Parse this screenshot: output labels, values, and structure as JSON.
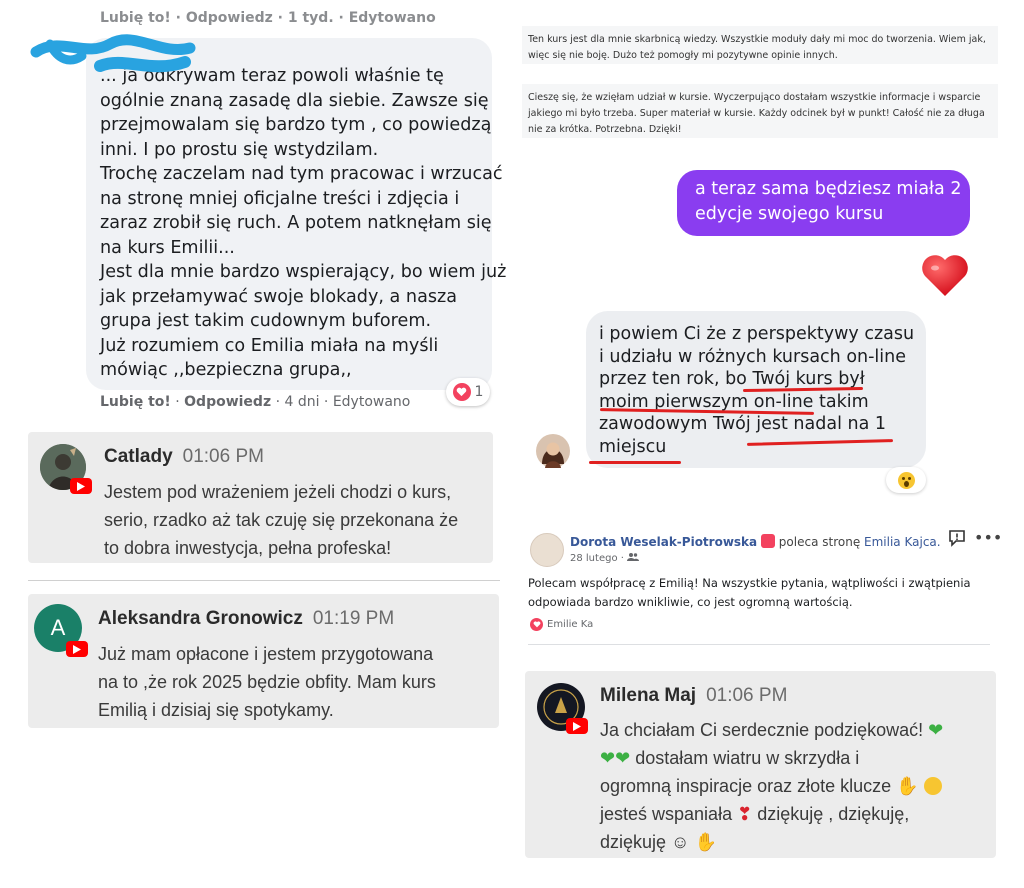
{
  "left": {
    "fb_comment": {
      "top_cut_text": "Lubię to! · Odpowiedz · 1 tyd. · Edytowano",
      "lines": [
        "... ja odkrywam teraz powoli właśnie tę",
        "ogólnie znaną zasadę dla siebie. Zawsze się",
        "przejmowalam się bardzo tym , co powiedzą",
        "inni. I po prostu się wstydzilam.",
        "Trochę zaczelam nad tym pracowac i wrzucać",
        "na stronę mniej oficjalne treści i zdjęcia i",
        "zaraz zrobił się ruch. A potem natknęłam się",
        "na kurs Emilii...",
        "Jest dla mnie bardzo wspierający, bo wiem już",
        "jak przełamywać swoje blokady, a nasza",
        "grupa jest takim cudownym buforem.",
        "Już rozumiem co Emilia miała na myśli",
        "mówiąc ,,bezpieczna grupa,,"
      ],
      "reaction_count": "1",
      "like_label": "Lubię to!",
      "reply_label": "Odpowiedz",
      "meta": "· 4 dni · Edytowano"
    },
    "yt_comments": [
      {
        "name": "Catlady",
        "time": "01:06 PM",
        "lines": [
          "Jestem pod wrażeniem jeżeli chodzi o kurs,",
          "serio, rzadko aż tak czuję się przekonana że",
          "to dobra inwestycja, pełna profeska!"
        ]
      },
      {
        "name": "Aleksandra Gronowicz",
        "time": "01:19 PM",
        "avatar_letter": "A",
        "lines": [
          "Już mam opłacone i jestem przygotowana",
          "na to ,że rok 2025 będzie obfity. Mam kurs",
          "Emilią i dzisiaj się spotykamy."
        ]
      }
    ]
  },
  "right": {
    "reviews": [
      "Ten kurs jest dla mnie skarbnicą wiedzy. Wszystkie moduły dały mi moc do tworzenia. Wiem jak, więc się nie boję. Dużo też pomogły mi pozytywne opinie innych.",
      "Cieszę się, że wzięłam udział w kursie. Wyczerpująco dostałam wszystkie informacje i wsparcie jakiego mi było trzeba. Super materiał w kursie. Każdy odcinek był w punkt! Całość nie za długa nie za krótka. Potrzebna. Dzięki!"
    ],
    "chat": {
      "sent_lines": [
        "a teraz sama będziesz miała 2",
        "edycje swojego kursu"
      ],
      "received_lines": [
        "i powiem Ci że z perspektywy czasu",
        "i udziału w różnych kursach on-line",
        "przez ten rok, bo Twój kurs był",
        "moim pierwszym on-line takim",
        "zawodowym Twój jest nadal na 1",
        "miejscu"
      ]
    },
    "recommendation": {
      "author": "Dorota Weselak-Piotrowska",
      "action": "poleca stronę",
      "page": "Emilia Kajca.",
      "date": "28 lutego ·",
      "text": "Polecam współpracę z Emilią! Na wszystkie pytania, wątpliwości i zwątpienia odpowiada bardzo wnikliwie, co jest ogromną wartością.",
      "reactor": "Emilie Ka",
      "more_icon": "•••"
    },
    "yt_comment": {
      "name": "Milena Maj",
      "time": "01:06 PM",
      "lines": [
        "Ja chciałam Ci serdecznie podziękować!",
        "dostałam wiatru w skrzydła i",
        "ogromną inspiracje oraz złote klucze",
        "jesteś wspaniała",
        "dziękuję , dziękuję,",
        "dziękuję ☺"
      ]
    }
  },
  "colors": {
    "purple_bubble": "#8a3df0",
    "youtube_red": "#ff0000",
    "underline_red": "#e02020",
    "fb_link": "#385898"
  }
}
